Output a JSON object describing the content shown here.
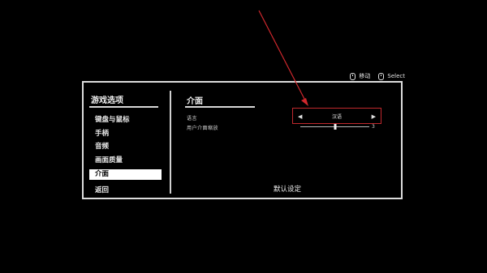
{
  "hints": [
    {
      "icon": "mouse-icon",
      "label": "移动"
    },
    {
      "icon": "mouse-icon",
      "label": "Select"
    }
  ],
  "sidebar": {
    "title": "游戏选项",
    "items": [
      {
        "label": "键盘与鼠标"
      },
      {
        "label": "手柄"
      },
      {
        "label": "音频"
      },
      {
        "label": "画面质量"
      },
      {
        "label": "介面",
        "active": true
      }
    ],
    "back_label": "返回"
  },
  "content": {
    "title": "介面",
    "language": {
      "label": "语言",
      "value": "汉语"
    },
    "ui_scale": {
      "label": "用户介面缩放",
      "value": "3",
      "level": 0.5
    },
    "defaults_label": "默认设定"
  },
  "colors": {
    "background": "#000000",
    "panel_border": "#dcdcdc",
    "highlight_box": "#c0282d",
    "annotation_arrow": "#d0282d"
  }
}
